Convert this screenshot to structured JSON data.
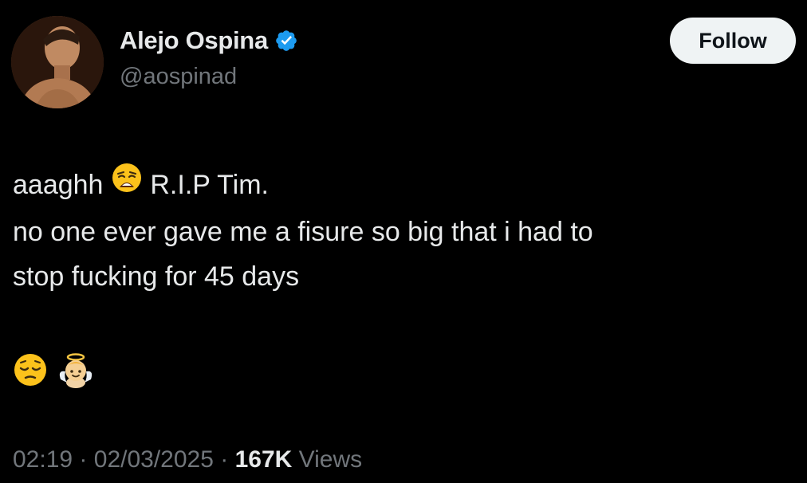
{
  "user": {
    "display_name": "Alejo Ospina",
    "handle": "@aospinad",
    "verified_color": "#1d9bf0"
  },
  "follow_button": {
    "label": "Follow"
  },
  "tweet": {
    "line1_prefix": "aaaghh",
    "line1_emoji": "weary-face-emoji",
    "line1_suffix": "R.I.P Tim.",
    "line2": "no one ever gave me a fisure so big that i had to",
    "line3": "stop fucking for 45 days",
    "trailing_emojis": [
      "pensive-face-emoji",
      "baby-angel-emoji"
    ]
  },
  "meta": {
    "time": "02:19",
    "separator": "·",
    "date": "02/03/2025",
    "views_count": "167K",
    "views_label": "Views"
  }
}
